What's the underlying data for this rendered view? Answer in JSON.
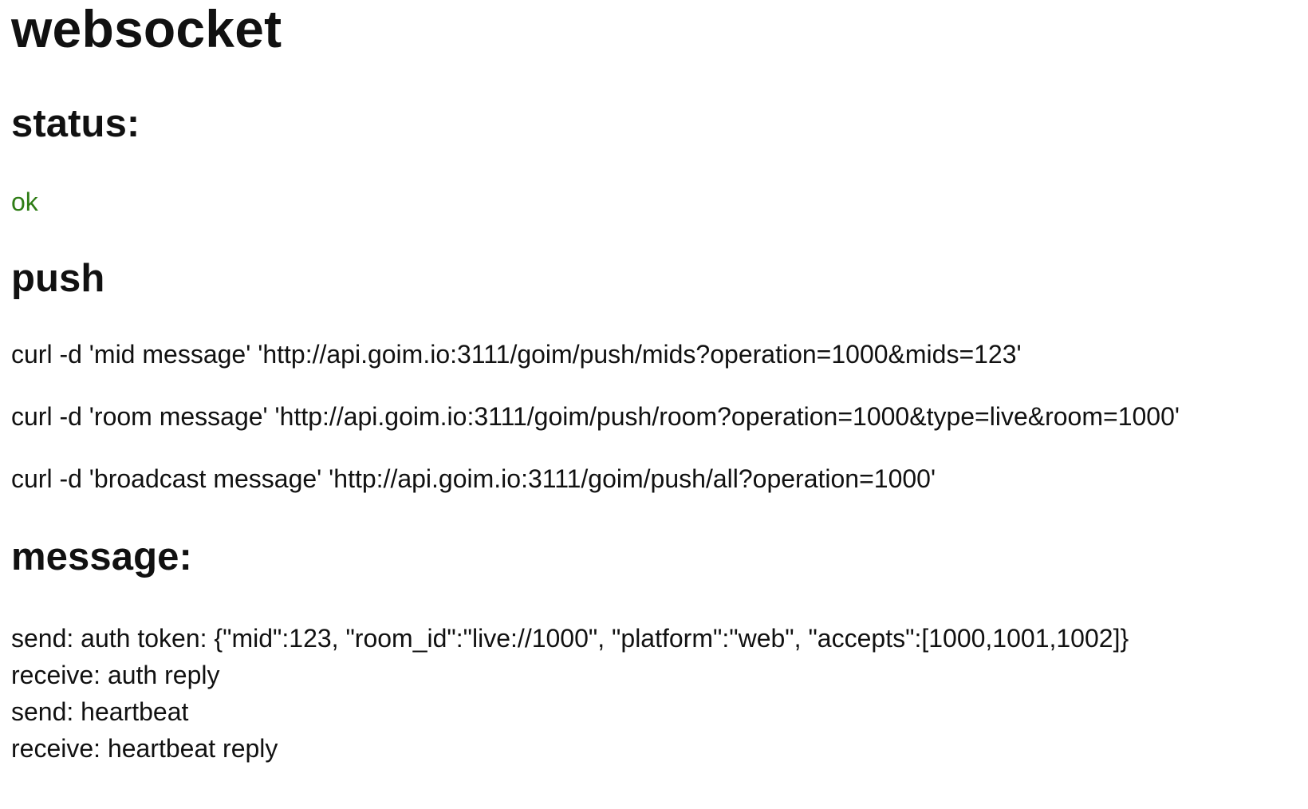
{
  "title": "websocket",
  "status": {
    "heading": "status:",
    "value": "ok"
  },
  "push": {
    "heading": "push",
    "commands": [
      "curl -d 'mid message' 'http://api.goim.io:3111/goim/push/mids?operation=1000&mids=123'",
      "curl -d 'room message' 'http://api.goim.io:3111/goim/push/room?operation=1000&type=live&room=1000'",
      "curl -d 'broadcast message' 'http://api.goim.io:3111/goim/push/all?operation=1000'"
    ]
  },
  "message": {
    "heading": "message:",
    "lines": [
      "send: auth token: {\"mid\":123, \"room_id\":\"live://1000\", \"platform\":\"web\", \"accepts\":[1000,1001,1002]}",
      "receive: auth reply",
      "send: heartbeat",
      "receive: heartbeat reply"
    ]
  },
  "colors": {
    "status_ok": "#2f7d16",
    "text": "#111111",
    "background": "#ffffff"
  }
}
